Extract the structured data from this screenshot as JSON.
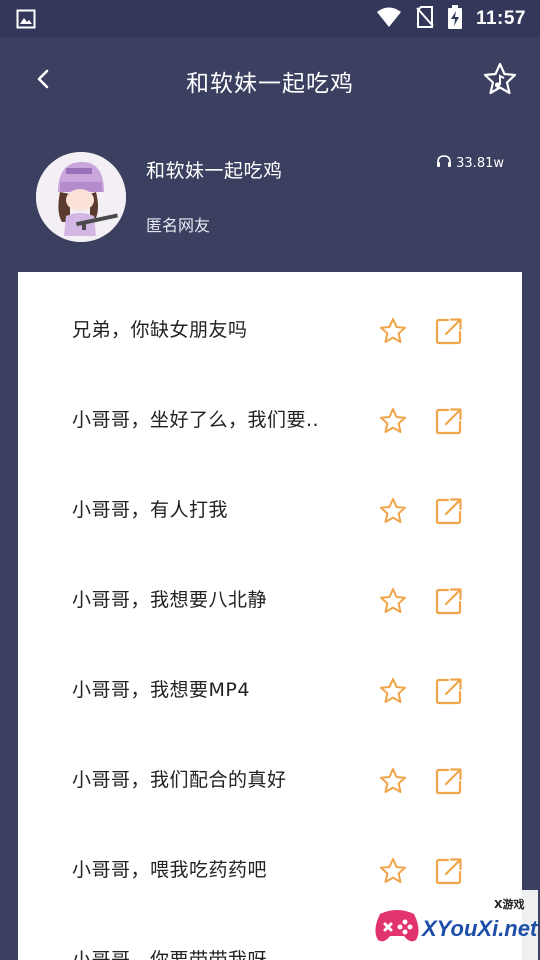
{
  "status_bar": {
    "time": "11:57",
    "icons": [
      "image-icon",
      "wifi-icon",
      "no-sim-icon",
      "battery-charging-icon"
    ]
  },
  "app_bar": {
    "title": "和软妹一起吃鸡",
    "back_icon": "back-arrow-icon",
    "action_icon": "star-music-icon"
  },
  "album": {
    "title": "和软妹一起吃鸡",
    "author": "匿名网友",
    "play_count": "33.81w",
    "play_icon": "headphones-icon"
  },
  "list": {
    "items": [
      {
        "text": "兄弟，你缺女朋友吗"
      },
      {
        "text": "小哥哥，坐好了么，我们要.."
      },
      {
        "text": "小哥哥，有人打我"
      },
      {
        "text": "小哥哥，我想要八北静"
      },
      {
        "text": "小哥哥，我想要MP4"
      },
      {
        "text": "小哥哥，我们配合的真好"
      },
      {
        "text": "小哥哥，喂我吃药药吧"
      },
      {
        "text": "小哥哥，你要带带我呀"
      }
    ]
  },
  "watermark": {
    "small": "X游戏",
    "big": "XYouXi.net"
  },
  "colors": {
    "background": "#3b4060",
    "status_bar": "#33385a",
    "accent": "#f0a54a",
    "card": "#ffffff"
  }
}
